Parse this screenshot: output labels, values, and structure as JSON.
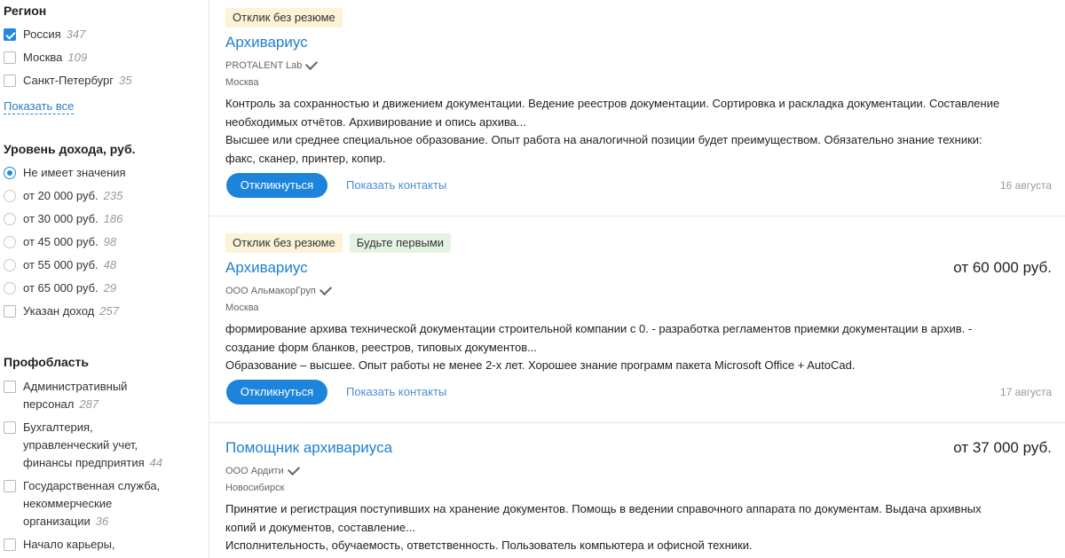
{
  "region": {
    "title": "Регион",
    "items": [
      {
        "label": "Россия",
        "count": "347",
        "checked": true
      },
      {
        "label": "Москва",
        "count": "109",
        "checked": false
      },
      {
        "label": "Санкт-Петербург",
        "count": "35",
        "checked": false
      }
    ],
    "show_all": "Показать все"
  },
  "income": {
    "title": "Уровень дохода, руб.",
    "items": [
      {
        "label": "Не имеет значения",
        "count": "",
        "selected": true
      },
      {
        "label": "от 20 000 руб.",
        "count": "235"
      },
      {
        "label": "от 30 000 руб.",
        "count": "186"
      },
      {
        "label": "от 45 000 руб.",
        "count": "98"
      },
      {
        "label": "от 55 000 руб.",
        "count": "48"
      },
      {
        "label": "от 65 000 руб.",
        "count": "29"
      }
    ],
    "specified": {
      "label": "Указан доход",
      "count": "257"
    }
  },
  "prof": {
    "title": "Профобласть",
    "items": [
      {
        "lines": [
          "Административный"
        ],
        "last": "персонал",
        "count": "287"
      },
      {
        "lines": [
          "Бухгалтерия,",
          "управленческий учет,"
        ],
        "last": "финансы предприятия",
        "count": "44"
      },
      {
        "lines": [
          "Государственная служба,",
          "некоммерческие"
        ],
        "last": "организации",
        "count": "36"
      },
      {
        "lines": [
          "Начало карьеры,"
        ],
        "last": "",
        "count": ""
      }
    ]
  },
  "vacancies": [
    {
      "tags": [
        "Отклик без резюме"
      ],
      "title": "Архивариус",
      "salary": "",
      "company": "PROTALENT Lab",
      "city": "Москва",
      "desc": [
        "Контроль за сохранностью и движением документации. Ведение реестров документации. Сортировка и раскладка документации. Составление",
        "необходимых отчётов. Архивирование и опись архива...",
        "Высшее или среднее специальное образование. Опыт работа на аналогичной позиции будет преимуществом. Обязательно знание техники:",
        "факс, сканер, принтер, копир."
      ],
      "apply": "Откликнуться",
      "contacts": "Показать контакты",
      "date": "16 августа"
    },
    {
      "tags": [
        "Отклик без резюме",
        "Будьте первыми"
      ],
      "title": "Архивариус",
      "salary": "от 60 000 руб.",
      "company": "ООО АльмакорГруп",
      "city": "Москва",
      "desc": [
        "формирование архива технической документации строительной компании с 0. - разработка регламентов приемки документации в архив. -",
        "создание форм бланков, реестров, типовых документов...",
        "Образование – высшее. Опыт работы не менее 2-х лет. Хорошее знание программ пакета Microsoft Office + AutoCad."
      ],
      "apply": "Откликнуться",
      "contacts": "Показать контакты",
      "date": "17 августа"
    },
    {
      "tags": [],
      "title": "Помощник архивариуса",
      "salary": "от 37 000 руб.",
      "company": "ООО Ардити",
      "city": "Новосибирск",
      "desc": [
        "Принятие и регистрация поступивших на хранение документов. Помощь в ведении справочного аппарата по документам. Выдача архивных",
        "копий и документов, составление...",
        "Исполнительность, обучаемость, ответственность. Пользователь компьютера и офисной техники."
      ],
      "apply": "",
      "contacts": "",
      "date": ""
    }
  ]
}
